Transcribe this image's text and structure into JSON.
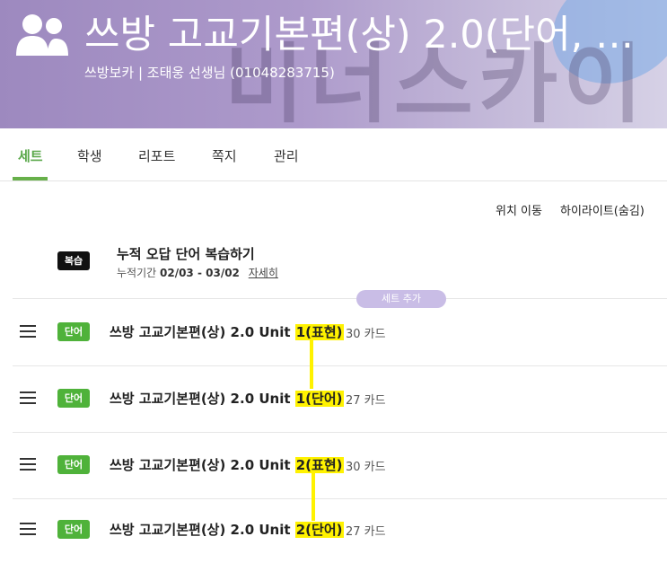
{
  "header": {
    "title": "쓰방 고교기본편(상) 2.0(단어, …",
    "subtitle": "쓰방보카 | 조태웅 선생님  (01048283715)",
    "watermark": "비너스카이",
    "accent_color": "#a592c4",
    "icon": "group-icon"
  },
  "tabs": [
    {
      "label": "세트",
      "active": true
    },
    {
      "label": "학생",
      "active": false
    },
    {
      "label": "리포트",
      "active": false
    },
    {
      "label": "쪽지",
      "active": false
    },
    {
      "label": "관리",
      "active": false
    }
  ],
  "toolbar": {
    "move_label": "위치 이동",
    "highlight_label": "하이라이트(숨김)"
  },
  "review": {
    "badge": "복습",
    "title": "누적 오답 단어 복습하기",
    "period_label": "누적기간",
    "period_value": "02/03 - 03/02",
    "detail_link": "자세히"
  },
  "add_set_label": "세트 추가",
  "sets": [
    {
      "badge": "단어",
      "title_prefix": "쓰방 고교기본편(상) 2.0 Unit ",
      "title_highlight": "1(표현)",
      "count": "30 카드"
    },
    {
      "badge": "단어",
      "title_prefix": "쓰방 고교기본편(상) 2.0 Unit ",
      "title_highlight": "1(단어)",
      "count": "27 카드"
    },
    {
      "badge": "단어",
      "title_prefix": "쓰방 고교기본편(상) 2.0 Unit ",
      "title_highlight": "2(표현)",
      "count": "30 카드"
    },
    {
      "badge": "단어",
      "title_prefix": "쓰방 고교기본편(상) 2.0 Unit ",
      "title_highlight": "2(단어)",
      "count": "27 카드"
    }
  ],
  "colors": {
    "tab_active": "#5aa84a",
    "badge_green": "#4fb23a",
    "badge_black": "#111111",
    "add_set_pill": "#c9bde6",
    "highlight": "#fff200"
  }
}
